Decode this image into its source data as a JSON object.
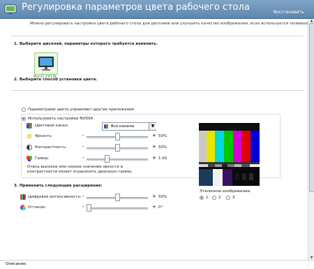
{
  "header": {
    "title": "Регулировка параметров цвета рабочего стола",
    "restore_link": "Восстановить",
    "icon": "nvidia-settings-icon",
    "bg_color": "#6b92b8"
  },
  "intro_text": "Можно регулировать настройки цвета рабочего стола для дисплеев или улучшить качество изображения, если используется телевизор.",
  "section1": {
    "heading": "1. Выберите дисплей, параметры которого требуется изменить.",
    "display_name": "BenQ 241W"
  },
  "section2": {
    "heading": "2. Выберите способ установки цвета.",
    "options": [
      {
        "label": "Параметрами цвета управляют другие приложения",
        "selected": false
      },
      {
        "label": "Использовать настройки NVIDIA",
        "selected": true
      }
    ],
    "color_channel_label": "Цветовой канал:",
    "color_channel_value": "Все каналы",
    "brightness": {
      "label": "Яркость:",
      "minus": "-",
      "plus": "+",
      "value": "50%",
      "level": 0.5
    },
    "contrast": {
      "label": "Контрастность:",
      "minus": "-",
      "plus": "+",
      "value": "50%",
      "level": 0.5
    },
    "gamma": {
      "label": "Гамма:",
      "minus": "-",
      "plus": "+",
      "value": "1.00",
      "level": 0.32
    },
    "warning": "Очень высокое или низкое значение яркости и контрастности может ограничить диапазон гаммы."
  },
  "section3": {
    "heading": "3. Применить следующие расширения:",
    "digital_vibrance": {
      "label": "Цифровая интенсивность:",
      "minus": "-",
      "plus": "+",
      "value": "50%",
      "level": 0.5
    },
    "hue": {
      "label": "Оттенок:",
      "minus": "-",
      "plus": "+",
      "value": "0°",
      "level": 0.0
    }
  },
  "reference": {
    "label": "Эталонное изображение:",
    "options": [
      {
        "label": "1",
        "selected": true
      },
      {
        "label": "2",
        "selected": false
      },
      {
        "label": "3",
        "selected": false
      }
    ]
  },
  "status_bar": {
    "description_label": "Описание:"
  }
}
